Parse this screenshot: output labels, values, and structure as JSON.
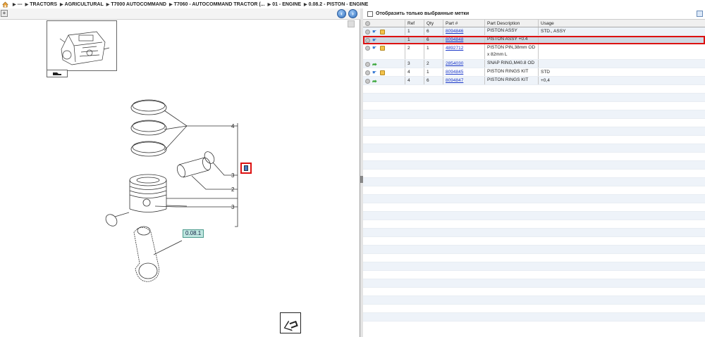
{
  "breadcrumb": {
    "items": [
      "---",
      "TRACTORS",
      "AGRICULTURAL",
      "T7000 AUTOCOMMAND",
      "T7060 - AUTOCOMMAND TRACTOR (...",
      "01 - ENGINE",
      "0.08.2 - PISTON - ENGINE"
    ]
  },
  "left_pane": {
    "callouts": [
      "4",
      "3",
      "2",
      "3"
    ],
    "group_ref": "0.08.1"
  },
  "right_pane": {
    "filter_label": "Отобразить только выбранные метки",
    "columns": [
      "",
      "Ref",
      "Qty",
      "Part #",
      "Part Description",
      "Usage"
    ],
    "rows": [
      {
        "ref": "1",
        "qty": "6",
        "part": "8094846",
        "desc": "PISTON ASSY",
        "usage": "STD., ASSY",
        "icon": "cart"
      },
      {
        "ref": "1",
        "qty": "6",
        "part": "8094848",
        "desc": "PISTON ASSY   +0.4",
        "usage": "",
        "icon": "hand"
      },
      {
        "ref": "2",
        "qty": "1",
        "part": "4892712",
        "desc": "PISTON PIN,38mm OD x 82mm L",
        "usage": "",
        "icon": "cart"
      },
      {
        "ref": "3",
        "qty": "2",
        "part": "2854030",
        "desc": "SNAP RING,M40.8 OD",
        "usage": "",
        "icon": "arrow"
      },
      {
        "ref": "4",
        "qty": "1",
        "part": "8094845",
        "desc": "PISTON RINGS KIT",
        "usage": "STD",
        "icon": "cart"
      },
      {
        "ref": "4",
        "qty": "6",
        "part": "8094847",
        "desc": "PISTON RINGS KIT",
        "usage": "+0,4",
        "icon": "arrow"
      }
    ]
  },
  "colors": {
    "selection_outline": "#d11111",
    "link": "#1a37c8",
    "row_alt": "#eef3f9",
    "ref_box": "#bfe6e0"
  },
  "icons": [
    "home-icon",
    "zoom-icon",
    "back-icon",
    "forward-icon",
    "info-icon",
    "hand-icon",
    "cart-icon",
    "arrow-icon",
    "export-icon",
    "next-page-icon"
  ]
}
